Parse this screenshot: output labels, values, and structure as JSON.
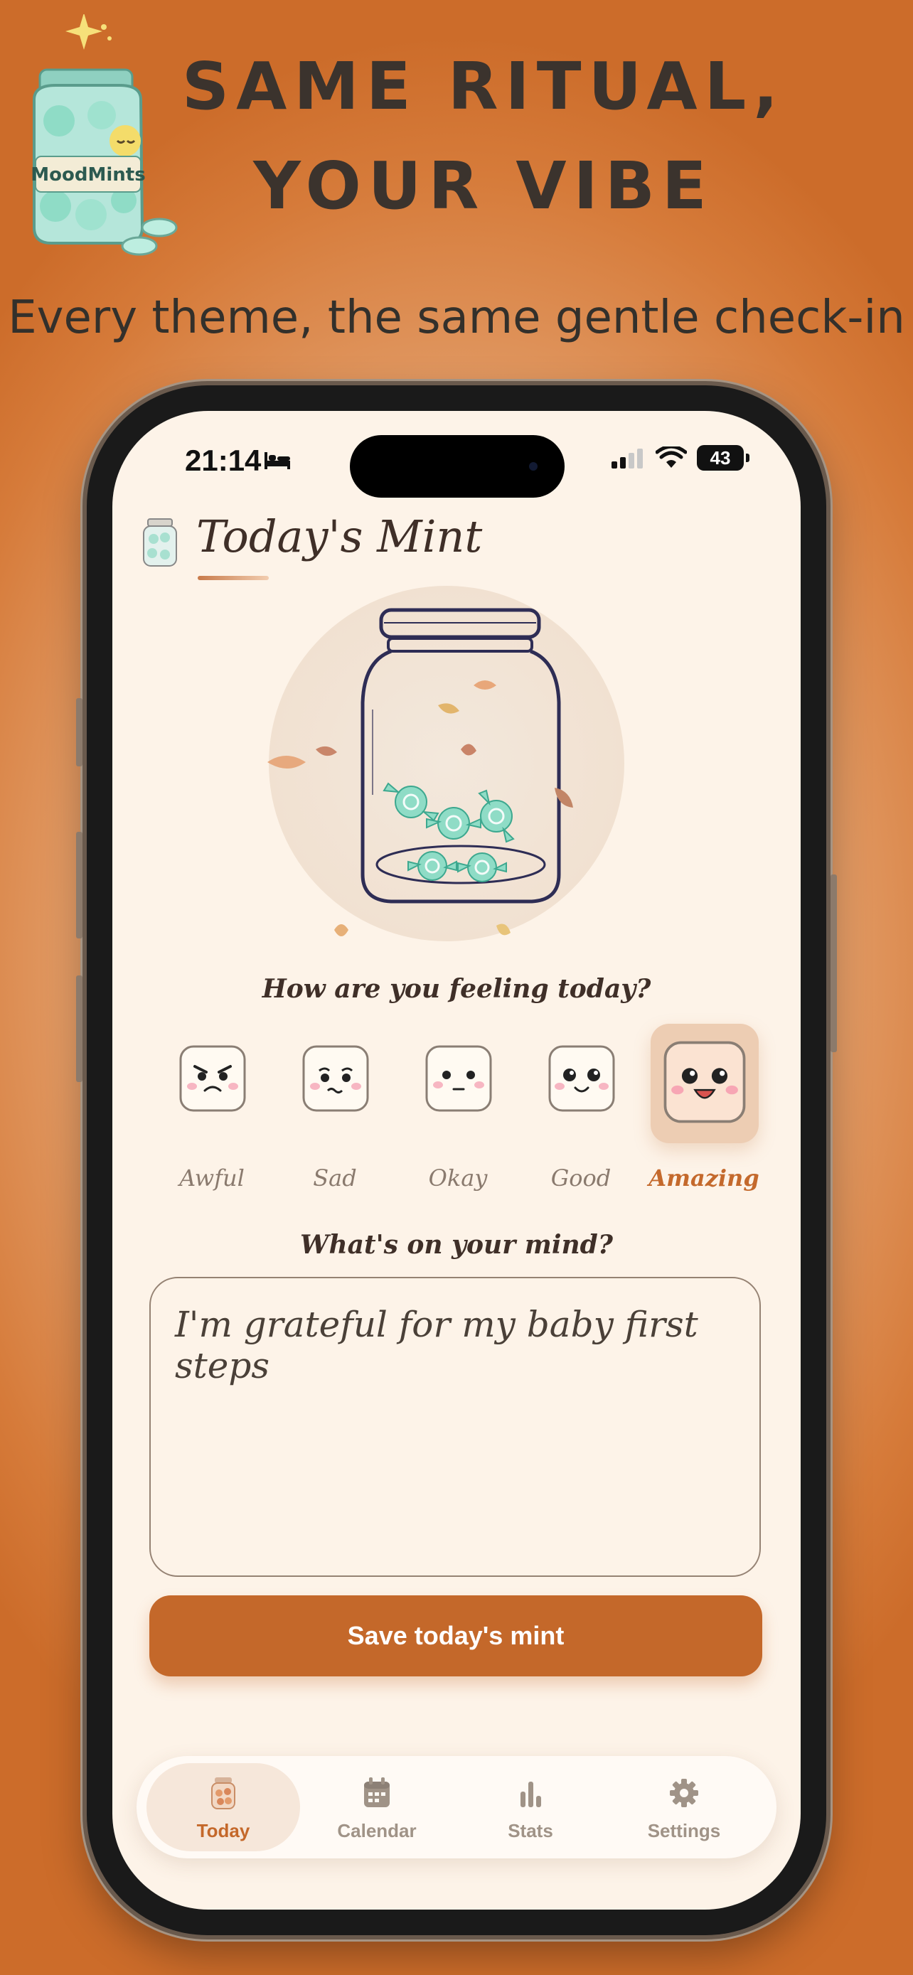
{
  "promo": {
    "headline_line1": "SAME RITUAL,",
    "headline_line2": "YOUR VIBE",
    "subheadline": "Every theme, the same gentle check-in",
    "logo_text": "MoodMints"
  },
  "status_bar": {
    "time": "21:14",
    "battery": "43"
  },
  "header": {
    "title": "Today's Mint"
  },
  "mood_prompt": "How are you feeling today?",
  "moods": [
    {
      "label": "Awful",
      "selected": false
    },
    {
      "label": "Sad",
      "selected": false
    },
    {
      "label": "Okay",
      "selected": false
    },
    {
      "label": "Good",
      "selected": false
    },
    {
      "label": "Amazing",
      "selected": true
    }
  ],
  "note_prompt": "What's on your mind?",
  "note_value": "I'm grateful for my baby first steps",
  "save_button": "Save today's mint",
  "tab_bar": {
    "tabs": [
      {
        "label": "Today",
        "active": true
      },
      {
        "label": "Calendar",
        "active": false
      },
      {
        "label": "Stats",
        "active": false
      },
      {
        "label": "Settings",
        "active": false
      }
    ]
  },
  "colors": {
    "accent": "#c4682a",
    "background": "#fdf3e8",
    "mint": "#8fdcc6",
    "ink": "#2e2d55"
  }
}
